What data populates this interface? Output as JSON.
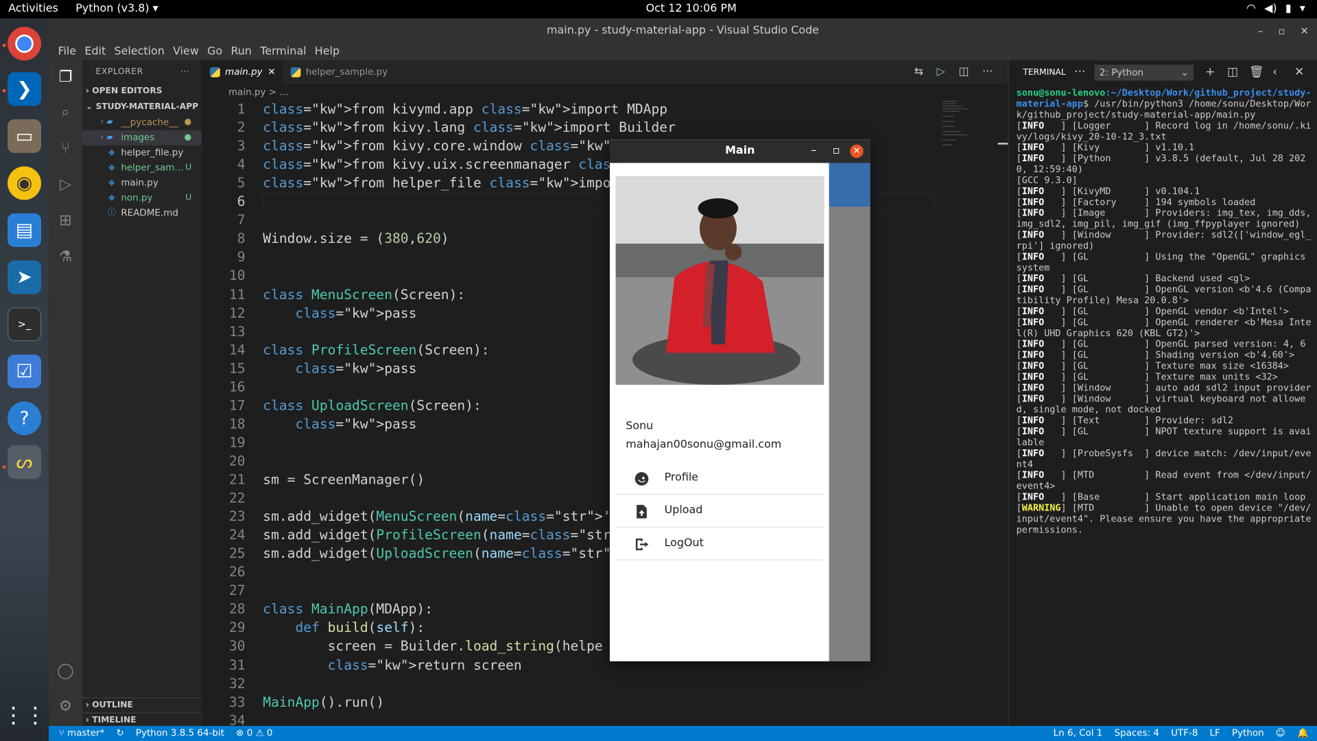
{
  "topbar": {
    "activities": "Activities",
    "app_menu": "Python (v3.8) ▾",
    "clock": "Oct 12  10:06 PM"
  },
  "window": {
    "title": "main.py - study-material-app - Visual Studio Code"
  },
  "menu": [
    "File",
    "Edit",
    "Selection",
    "View",
    "Go",
    "Run",
    "Terminal",
    "Help"
  ],
  "sidebar": {
    "explorer_label": "EXPLORER",
    "open_editors": "OPEN EDITORS",
    "project": "STUDY-MATERIAL-APP",
    "files": [
      {
        "name": "__pycache__",
        "type": "folder",
        "badge": "●",
        "color": "#c09553"
      },
      {
        "name": "images",
        "type": "folder",
        "badge": "●",
        "color": "#73c991"
      },
      {
        "name": "helper_file.py",
        "type": "py",
        "badge": "",
        "color": "#cccccc"
      },
      {
        "name": "helper_sam...",
        "type": "py",
        "badge": "U",
        "color": "#73c991"
      },
      {
        "name": "main.py",
        "type": "py",
        "badge": "",
        "color": "#cccccc"
      },
      {
        "name": "non.py",
        "type": "py",
        "badge": "U",
        "color": "#73c991"
      },
      {
        "name": "README.md",
        "type": "md",
        "badge": "",
        "color": "#cccccc"
      }
    ],
    "outline": "OUTLINE",
    "timeline": "TIMELINE"
  },
  "tabs": [
    {
      "label": "main.py",
      "active": true
    },
    {
      "label": "helper_sample.py",
      "active": false
    }
  ],
  "breadcrumb": "main.py > ...",
  "code_lines": [
    "from kivymd.app import MDApp",
    "from kivy.lang import Builder",
    "from kivy.core.window import Window",
    "from kivy.uix.screenmanager import Screen,",
    "from helper_file import helper_str",
    "",
    "",
    "Window.size = (380,620)",
    "",
    "",
    "class MenuScreen(Screen):",
    "    pass",
    "",
    "class ProfileScreen(Screen):",
    "    pass",
    "",
    "class UploadScreen(Screen):",
    "    pass",
    "",
    "",
    "sm = ScreenManager()",
    "",
    "sm.add_widget(MenuScreen(name='menu'))",
    "sm.add_widget(ProfileScreen(name='profile'",
    "sm.add_widget(UploadScreen(name='upload'))",
    "",
    "",
    "class MainApp(MDApp):",
    "    def build(self):",
    "        screen = Builder.load_string(helpe",
    "        return screen",
    "",
    "MainApp().run()",
    ""
  ],
  "terminal": {
    "label": "TERMINAL",
    "selector": "2: Python",
    "prompt_user": "sonu@sonu-lenovo",
    "prompt_path": ":~/Desktop/Work/github_project/study-material-app",
    "command": "$ /usr/bin/python3 /home/sonu/Desktop/Work/github_project/study-material-app/main.py",
    "log": [
      [
        "INFO",
        "   ] [Logger      ] Record log in /home/sonu/.kivy/logs/kivy_20-10-12_3.txt"
      ],
      [
        "INFO",
        "   ] [Kivy        ] v1.10.1"
      ],
      [
        "INFO",
        "   ] [Python      ] v3.8.5 (default, Jul 28 2020, 12:59:40)"
      ],
      [
        "",
        "[GCC 9.3.0]"
      ],
      [
        "INFO",
        "   ] [KivyMD      ] v0.104.1"
      ],
      [
        "INFO",
        "   ] [Factory     ] 194 symbols loaded"
      ],
      [
        "INFO",
        "   ] [Image       ] Providers: img_tex, img_dds, img_sdl2, img_pil, img_gif (img_ffpyplayer ignored)"
      ],
      [
        "INFO",
        "   ] [Window      ] Provider: sdl2(['window_egl_rpi'] ignored)"
      ],
      [
        "INFO",
        "   ] [GL          ] Using the \"OpenGL\" graphics system"
      ],
      [
        "INFO",
        "   ] [GL          ] Backend used <gl>"
      ],
      [
        "INFO",
        "   ] [GL          ] OpenGL version <b'4.6 (Compatibility Profile) Mesa 20.0.8'>"
      ],
      [
        "INFO",
        "   ] [GL          ] OpenGL vendor <b'Intel'>"
      ],
      [
        "INFO",
        "   ] [GL          ] OpenGL renderer <b'Mesa Intel(R) UHD Graphics 620 (KBL GT2)'>"
      ],
      [
        "INFO",
        "   ] [GL          ] OpenGL parsed version: 4, 6"
      ],
      [
        "INFO",
        "   ] [GL          ] Shading version <b'4.60'>"
      ],
      [
        "INFO",
        "   ] [GL          ] Texture max size <16384>"
      ],
      [
        "INFO",
        "   ] [GL          ] Texture max units <32>"
      ],
      [
        "INFO",
        "   ] [Window      ] auto add sdl2 input provider"
      ],
      [
        "INFO",
        "   ] [Window      ] virtual keyboard not allowed, single mode, not docked"
      ],
      [
        "INFO",
        "   ] [Text        ] Provider: sdl2"
      ],
      [
        "INFO",
        "   ] [GL          ] NPOT texture support is available"
      ],
      [
        "INFO",
        "   ] [ProbeSysfs  ] device match: /dev/input/event4"
      ],
      [
        "INFO",
        "   ] [MTD         ] Read event from </dev/input/event4>"
      ],
      [
        "INFO",
        "   ] [Base        ] Start application main loop"
      ],
      [
        "WARNING",
        "] [MTD         ] Unable to open device \"/dev/input/event4\". Please ensure you have the appropriate permissions."
      ]
    ]
  },
  "kivy": {
    "title": "Main",
    "name": "Sonu",
    "email": "mahajan00sonu@gmail.com",
    "items": [
      {
        "label": "Profile",
        "icon": "face-profile-icon"
      },
      {
        "label": "Upload",
        "icon": "file-upload-icon"
      },
      {
        "label": "LogOut",
        "icon": "logout-icon"
      }
    ]
  },
  "status": {
    "branch": "master*",
    "interpreter": "Python 3.8.5 64-bit",
    "problems": "⊗ 0 ⚠ 0",
    "position": "Ln 6, Col 1",
    "spaces": "Spaces: 4",
    "encoding": "UTF-8",
    "eol": "LF",
    "language": "Python"
  },
  "colors": {
    "accent": "#007acc",
    "kivy_primary": "#1565c0",
    "ubuntu_orange": "#e95420"
  }
}
